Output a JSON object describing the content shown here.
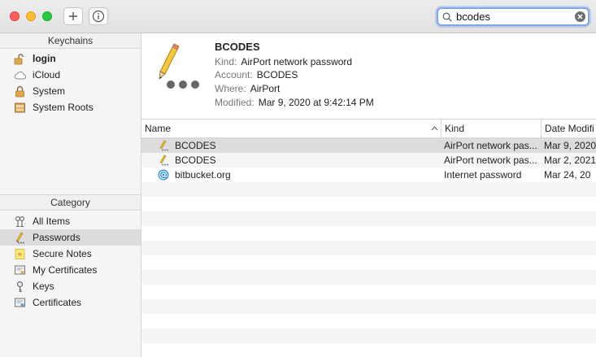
{
  "search": {
    "value": "bcodes"
  },
  "sidebar": {
    "keychains_header": "Keychains",
    "keychains": [
      {
        "label": "login",
        "icon": "lock-open-icon"
      },
      {
        "label": "iCloud",
        "icon": "cloud-icon"
      },
      {
        "label": "System",
        "icon": "lock-icon"
      },
      {
        "label": "System Roots",
        "icon": "cabinet-icon"
      }
    ],
    "category_header": "Category",
    "categories": [
      {
        "label": "All Items",
        "icon": "all-items-icon"
      },
      {
        "label": "Passwords",
        "icon": "pencil-icon"
      },
      {
        "label": "Secure Notes",
        "icon": "note-icon"
      },
      {
        "label": "My Certificates",
        "icon": "certificate-icon"
      },
      {
        "label": "Keys",
        "icon": "key-icon"
      },
      {
        "label": "Certificates",
        "icon": "certificate-icon"
      }
    ]
  },
  "detail": {
    "title": "BCODES",
    "kind_label": "Kind:",
    "kind": "AirPort network password",
    "account_label": "Account:",
    "account": "BCODES",
    "where_label": "Where:",
    "where": "AirPort",
    "modified_label": "Modified:",
    "modified": "Mar 9, 2020 at 9:42:14 PM"
  },
  "table": {
    "columns": {
      "name": "Name",
      "kind": "Kind",
      "date": "Date Modifi"
    },
    "rows": [
      {
        "name": "BCODES",
        "kind": "AirPort network pas...",
        "date": "Mar 9, 2020",
        "icon": "pencil-icon"
      },
      {
        "name": "BCODES",
        "kind": "AirPort network pas...",
        "date": "Mar 2, 2021",
        "icon": "pencil-icon"
      },
      {
        "name": "bitbucket.org",
        "kind": "Internet password",
        "date": "Mar 24, 20",
        "icon": "at-sign-icon"
      }
    ]
  },
  "colors": {
    "selection": "#dcdcdc",
    "close": "#fe5f57",
    "minimize": "#febc2e",
    "zoom": "#28c840",
    "search_focus": "#7fa6e6"
  }
}
